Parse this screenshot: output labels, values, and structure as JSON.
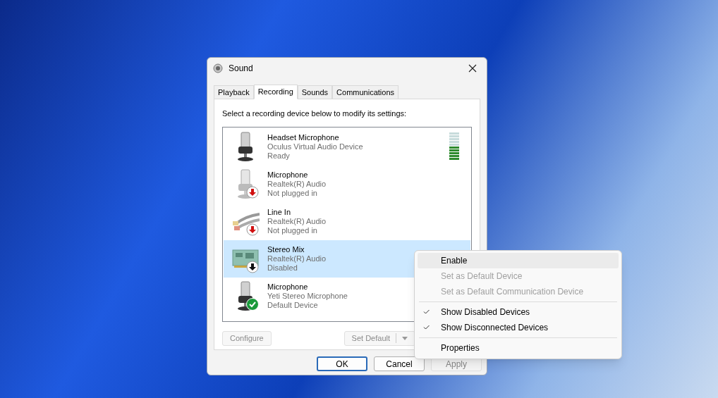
{
  "window": {
    "title": "Sound"
  },
  "tabs": [
    {
      "label": "Playback",
      "selected": false
    },
    {
      "label": "Recording",
      "selected": true
    },
    {
      "label": "Sounds",
      "selected": false
    },
    {
      "label": "Communications",
      "selected": false
    }
  ],
  "instruction": "Select a recording device below to modify its settings:",
  "devices": [
    {
      "kind": "mic",
      "name": "Headset Microphone",
      "driver": "Oculus Virtual Audio Device",
      "status": "Ready",
      "selected": false,
      "level": 0.5
    },
    {
      "kind": "mic-unplugged",
      "name": "Microphone",
      "driver": "Realtek(R) Audio",
      "status": "Not plugged in",
      "selected": false
    },
    {
      "kind": "line-in-unplugged",
      "name": "Line In",
      "driver": "Realtek(R) Audio",
      "status": "Not plugged in",
      "selected": false
    },
    {
      "kind": "stereo-mix-disabled",
      "name": "Stereo Mix",
      "driver": "Realtek(R) Audio",
      "status": "Disabled",
      "selected": true
    },
    {
      "kind": "mic-default",
      "name": "Microphone",
      "driver": "Yeti Stereo Microphone",
      "status": "Default Device",
      "selected": false
    }
  ],
  "panel_buttons": [
    {
      "label": "Configure",
      "disabled": true
    },
    {
      "label": "Set Default",
      "disabled": true
    }
  ],
  "dialog_buttons": [
    {
      "label": "OK",
      "disabled": false,
      "selected": true
    },
    {
      "label": "Cancel",
      "disabled": false,
      "selected": false
    },
    {
      "label": "Apply",
      "disabled": true,
      "selected": false
    }
  ],
  "context_menu": {
    "groups": [
      {
        "items": [
          {
            "label": "Enable",
            "disabled": false,
            "checked": false,
            "selected": true
          },
          {
            "label": "Set as Default Device",
            "disabled": true,
            "checked": false,
            "selected": false
          },
          {
            "label": "Set as Default Communication Device",
            "disabled": true,
            "checked": false,
            "selected": false
          }
        ]
      },
      {
        "items": [
          {
            "label": "Show Disabled Devices",
            "disabled": false,
            "checked": true,
            "selected": false
          },
          {
            "label": "Show Disconnected Devices",
            "disabled": false,
            "checked": true,
            "selected": false
          }
        ]
      },
      {
        "items": [
          {
            "label": "Properties",
            "disabled": false,
            "checked": false,
            "selected": false
          }
        ]
      }
    ]
  }
}
